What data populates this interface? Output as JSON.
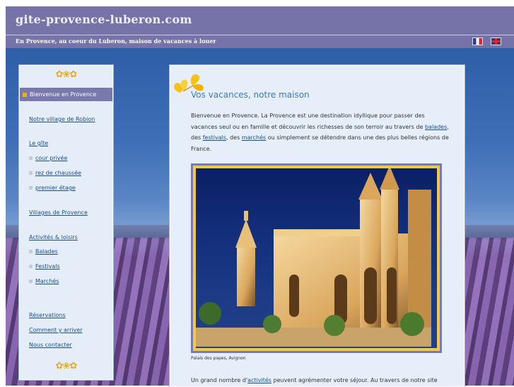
{
  "site": {
    "title": "gite-provence-luberon.com",
    "tagline": "En Provence, au coeur du Luberon, maison de vacances à louer"
  },
  "languages": [
    {
      "code": "fr",
      "icon": "flag-fr-icon"
    },
    {
      "code": "en",
      "icon": "flag-uk-icon"
    }
  ],
  "sidebar": {
    "active": "Bienvenue en Provence",
    "village": "Notre village de Robion",
    "gite": "Le gîte",
    "gite_sub": [
      "cour privée",
      "rez de chaussée",
      "premier étage"
    ],
    "villages": "Villages de Provence",
    "activites": "Activités & loisirs",
    "activites_sub": [
      "Balades",
      "Festivals",
      "Marchés"
    ],
    "reservations": "Réservations",
    "arriver": "Comment y arriver",
    "contact": "Nous contacter"
  },
  "main": {
    "heading": "Vos vacances, notre maison",
    "para_1": "Bienvenue en Provence. La Provence est une destination idyllique pour passer des vacances seul ou en famille et découvrir les richesses de son terroir au travers de",
    "link_balades": "balades",
    "sep_1": ", des",
    "link_festivals": "festivals",
    "sep_2": ", des",
    "link_marches": "marchés",
    "para_1_end": "ou simplement se détendre dans une des plus belles régions de France.",
    "caption": "Palais des papes, Avignon",
    "para_2_start": "Un grand nombre d'",
    "link_activites": "activités",
    "para_2_end": "peuvent agrémenter votre séjour. Au travers de notre site"
  },
  "colors": {
    "header": "#7673a8",
    "nav_active": "#7a79ad",
    "link": "#1b4f8a",
    "heading": "#3a7bbf",
    "frame_gold": "#f2c84a"
  }
}
